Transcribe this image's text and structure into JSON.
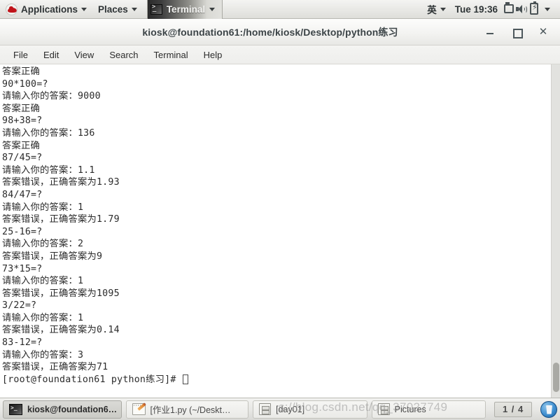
{
  "top_panel": {
    "logo": "redhat-logo",
    "applications_label": "Applications",
    "places_label": "Places",
    "window_task_label": "Terminal",
    "input_method": "英",
    "clock": "Tue 19:36",
    "tray": [
      "display-icon",
      "volume-icon",
      "battery-icon"
    ],
    "tray_caret": "chevron-down-icon"
  },
  "window": {
    "title": "kiosk@foundation61:/home/kiosk/Desktop/python练习",
    "buttons": {
      "minimize": "–",
      "maximize": "□",
      "close": "✕"
    },
    "menus": [
      "File",
      "Edit",
      "View",
      "Search",
      "Terminal",
      "Help"
    ]
  },
  "terminal": {
    "lines": [
      "答案正确",
      "90*100=?",
      "请输入你的答案：9000",
      "答案正确",
      "98+38=?",
      "请输入你的答案：136",
      "答案正确",
      "87/45=?",
      "请输入你的答案：1.1",
      "答案错误，正确答案为1.93",
      "84/47=?",
      "请输入你的答案：1",
      "答案错误，正确答案为1.79",
      "25-16=?",
      "请输入你的答案：2",
      "答案错误，正确答案为9",
      "73*15=?",
      "请输入你的答案：1",
      "答案错误，正确答案为1095",
      "3/22=?",
      "请输入你的答案：1",
      "答案错误，正确答案为0.14",
      "83-12=?",
      "请输入你的答案：3",
      "答案错误，正确答案为71"
    ],
    "prompt": "[root@foundation61 python练习]#"
  },
  "taskbar": {
    "tasks": [
      {
        "icon": "terminal-icon",
        "label": "kiosk@foundation6…",
        "active": true
      },
      {
        "icon": "gedit-icon",
        "label": "[作业1.py (~/Deskt…",
        "active": false
      },
      {
        "icon": "file-manager-icon",
        "label": "[day01]",
        "active": false
      },
      {
        "icon": "file-manager-icon",
        "label": "Pictures",
        "active": false
      }
    ],
    "workspace_indicator": "1 / 4",
    "trash": "trash-icon"
  },
  "watermark": "s://blog.csdn.net/qq_37027749"
}
